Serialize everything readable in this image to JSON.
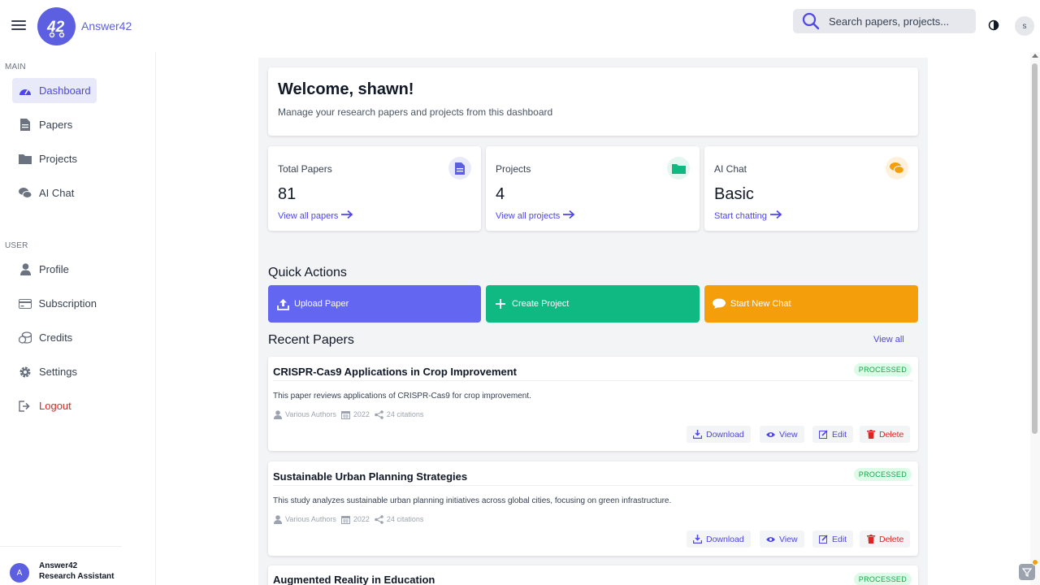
{
  "app": {
    "brand": "Answer42",
    "logo_text": "42"
  },
  "header": {
    "search_placeholder": "Search papers, projects...",
    "user_initial": "s"
  },
  "sidebar": {
    "main_label": "MAIN",
    "user_label": "USER",
    "main_items": [
      {
        "label": "Dashboard",
        "icon": "dashboard-icon",
        "active": true
      },
      {
        "label": "Papers",
        "icon": "file-icon"
      },
      {
        "label": "Projects",
        "icon": "folder-icon"
      },
      {
        "label": "AI Chat",
        "icon": "chat-icon"
      }
    ],
    "user_items": [
      {
        "label": "Profile",
        "icon": "user-icon"
      },
      {
        "label": "Subscription",
        "icon": "credit-card-icon"
      },
      {
        "label": "Credits",
        "icon": "coins-icon"
      },
      {
        "label": "Settings",
        "icon": "gear-icon"
      },
      {
        "label": "Logout",
        "icon": "logout-icon"
      }
    ],
    "footer": {
      "avatar": "A",
      "name": "Answer42",
      "subtitle": "Research Assistant"
    }
  },
  "welcome": {
    "title": "Welcome, shawn!",
    "subtitle": "Manage your research papers and projects from this dashboard"
  },
  "stats": [
    {
      "title": "Total Papers",
      "value": "81",
      "link": "View all papers",
      "icon": "file-icon",
      "color": "#5b5fe0",
      "bg": "#e9eaf9"
    },
    {
      "title": "Projects",
      "value": "4",
      "link": "View all projects",
      "icon": "folder-icon",
      "color": "#10b981",
      "bg": "#e3f6ef"
    },
    {
      "title": "AI Chat",
      "value": "Basic",
      "link": "Start chatting",
      "icon": "chat-icon",
      "color": "#f59e0b",
      "bg": "#fdf1dc"
    }
  ],
  "quick_actions": {
    "title": "Quick Actions",
    "items": [
      {
        "label": "Upload Paper",
        "icon": "upload-icon",
        "color": "#6366f1"
      },
      {
        "label": "Create Project",
        "icon": "plus-icon",
        "color": "#10b981"
      },
      {
        "label": "Start New Chat",
        "icon": "chat-bubble-icon",
        "color": "#f59e0b"
      }
    ]
  },
  "recent_papers": {
    "title": "Recent Papers",
    "view_all": "View all",
    "buttons": {
      "download": "Download",
      "view": "View",
      "edit": "Edit",
      "delete": "Delete"
    },
    "items": [
      {
        "title": "CRISPR-Cas9 Applications in Crop Improvement",
        "status": "PROCESSED",
        "description": "This paper reviews applications of CRISPR-Cas9 for crop improvement.",
        "authors": "Various Authors",
        "year": "2022",
        "citations": "24 citations"
      },
      {
        "title": "Sustainable Urban Planning Strategies",
        "status": "PROCESSED",
        "description": "This study analyzes sustainable urban planning initiatives across global cities, focusing on green infrastructure.",
        "authors": "Various Authors",
        "year": "2022",
        "citations": "24 citations"
      },
      {
        "title": "Augmented Reality in Education",
        "status": "PROCESSED"
      }
    ]
  }
}
